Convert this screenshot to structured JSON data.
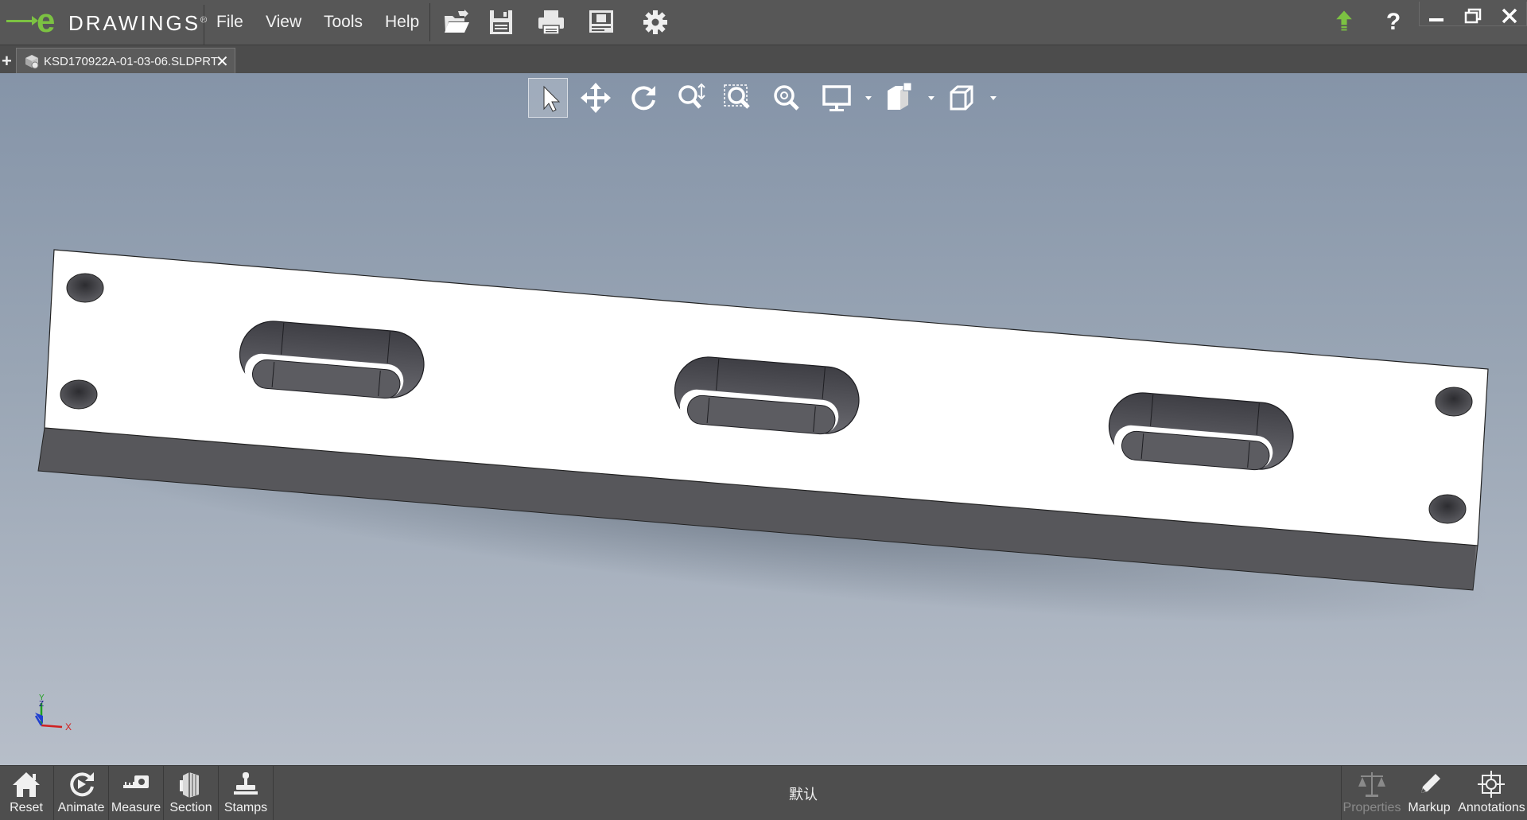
{
  "app": {
    "logo_letter": "e",
    "logo_word": "DRAWINGS",
    "logo_mark": "®"
  },
  "menu": [
    "File",
    "View",
    "Tools",
    "Help"
  ],
  "toolbar_icons": [
    "open-icon",
    "save-icon",
    "print-icon",
    "print-preview-icon",
    "settings-icon"
  ],
  "window_controls": [
    "update-arrow-icon",
    "help-icon",
    "minimize-icon",
    "restore-icon",
    "close-icon"
  ],
  "tab": {
    "title": "KSD170922A-01-03-06.SLDPRT",
    "close": "✕",
    "add": "+"
  },
  "view_toolbar": [
    "select-icon",
    "pan-icon",
    "rotate-icon",
    "zoom-icon",
    "zoom-to-area-icon",
    "zoom-to-fit-icon",
    "display-style-icon",
    "views-icon",
    "cube-view-icon"
  ],
  "triad": {
    "x": "X",
    "y": "Y",
    "z": "Z"
  },
  "bottom_left": [
    {
      "label": "Reset",
      "icon": "home-icon"
    },
    {
      "label": "Animate",
      "icon": "animate-icon"
    },
    {
      "label": "Measure",
      "icon": "measure-icon"
    },
    {
      "label": "Section",
      "icon": "section-icon"
    },
    {
      "label": "Stamps",
      "icon": "stamp-icon"
    }
  ],
  "configuration": "默认",
  "bottom_right": [
    {
      "label": "Properties",
      "icon": "scales-icon",
      "enabled": false
    },
    {
      "label": "Markup",
      "icon": "pencil-icon",
      "enabled": true
    },
    {
      "label": "Annotations",
      "icon": "annotation-icon",
      "enabled": true
    }
  ],
  "colors": {
    "accent": "#7cc242",
    "face_top": "#ffffff",
    "face_side": "#56565a"
  }
}
